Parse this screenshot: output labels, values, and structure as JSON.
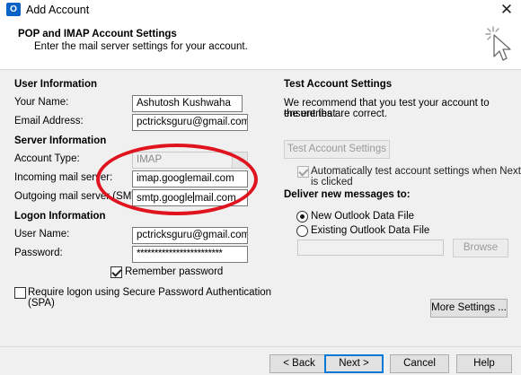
{
  "window": {
    "title": "Add Account",
    "close_glyph": "✕",
    "app_icon_letter": "O"
  },
  "header": {
    "title": "POP and IMAP Account Settings",
    "subtitle": "Enter the mail server settings for your account."
  },
  "user_info": {
    "section": "User Information",
    "name_label": "Your Name:",
    "name_value": "Ashutosh Kushwaha",
    "email_label": "Email Address:",
    "email_value": "pctricksguru@gmail.com"
  },
  "server_info": {
    "section": "Server Information",
    "account_type_label": "Account Type:",
    "account_type_value": "IMAP",
    "incoming_label": "Incoming mail server:",
    "incoming_value": "imap.googlemail.com",
    "outgoing_label": "Outgoing mail server (SMTP):",
    "outgoing_value_before_caret": "smtp.google",
    "outgoing_value_after_caret": "mail.com"
  },
  "logon_info": {
    "section": "Logon Information",
    "user_label": "User Name:",
    "user_value": "pctricksguru@gmail.com",
    "password_label": "Password:",
    "password_value": "************************",
    "remember_label": "Remember password",
    "remember_checked": true,
    "spa_label_line1": "Require logon using Secure Password Authentication",
    "spa_label_line2": "(SPA)",
    "spa_checked": false
  },
  "test_settings": {
    "section": "Test Account Settings",
    "description_line1": "We recommend that you test your account to ensure that",
    "description_line2": "the entries are correct.",
    "test_button": "Test Account Settings ...",
    "auto_test_line1": "Automatically test account settings when Next",
    "auto_test_line2": "is clicked",
    "auto_test_checked": true
  },
  "deliver": {
    "section": "Deliver new messages to:",
    "option_new": "New Outlook Data File",
    "option_existing": "Existing Outlook Data File",
    "selected": "New Outlook Data File",
    "browse_button": "Browse"
  },
  "buttons": {
    "more_settings": "More Settings ...",
    "back": "< Back",
    "next": "Next >",
    "cancel": "Cancel",
    "help": "Help"
  },
  "colors": {
    "annotation_circle": "#e0141e",
    "default_button_border": "#0078d7"
  },
  "icons": {
    "app": "outlook-icon",
    "header": "cursor-click-icon",
    "close": "close-icon"
  }
}
